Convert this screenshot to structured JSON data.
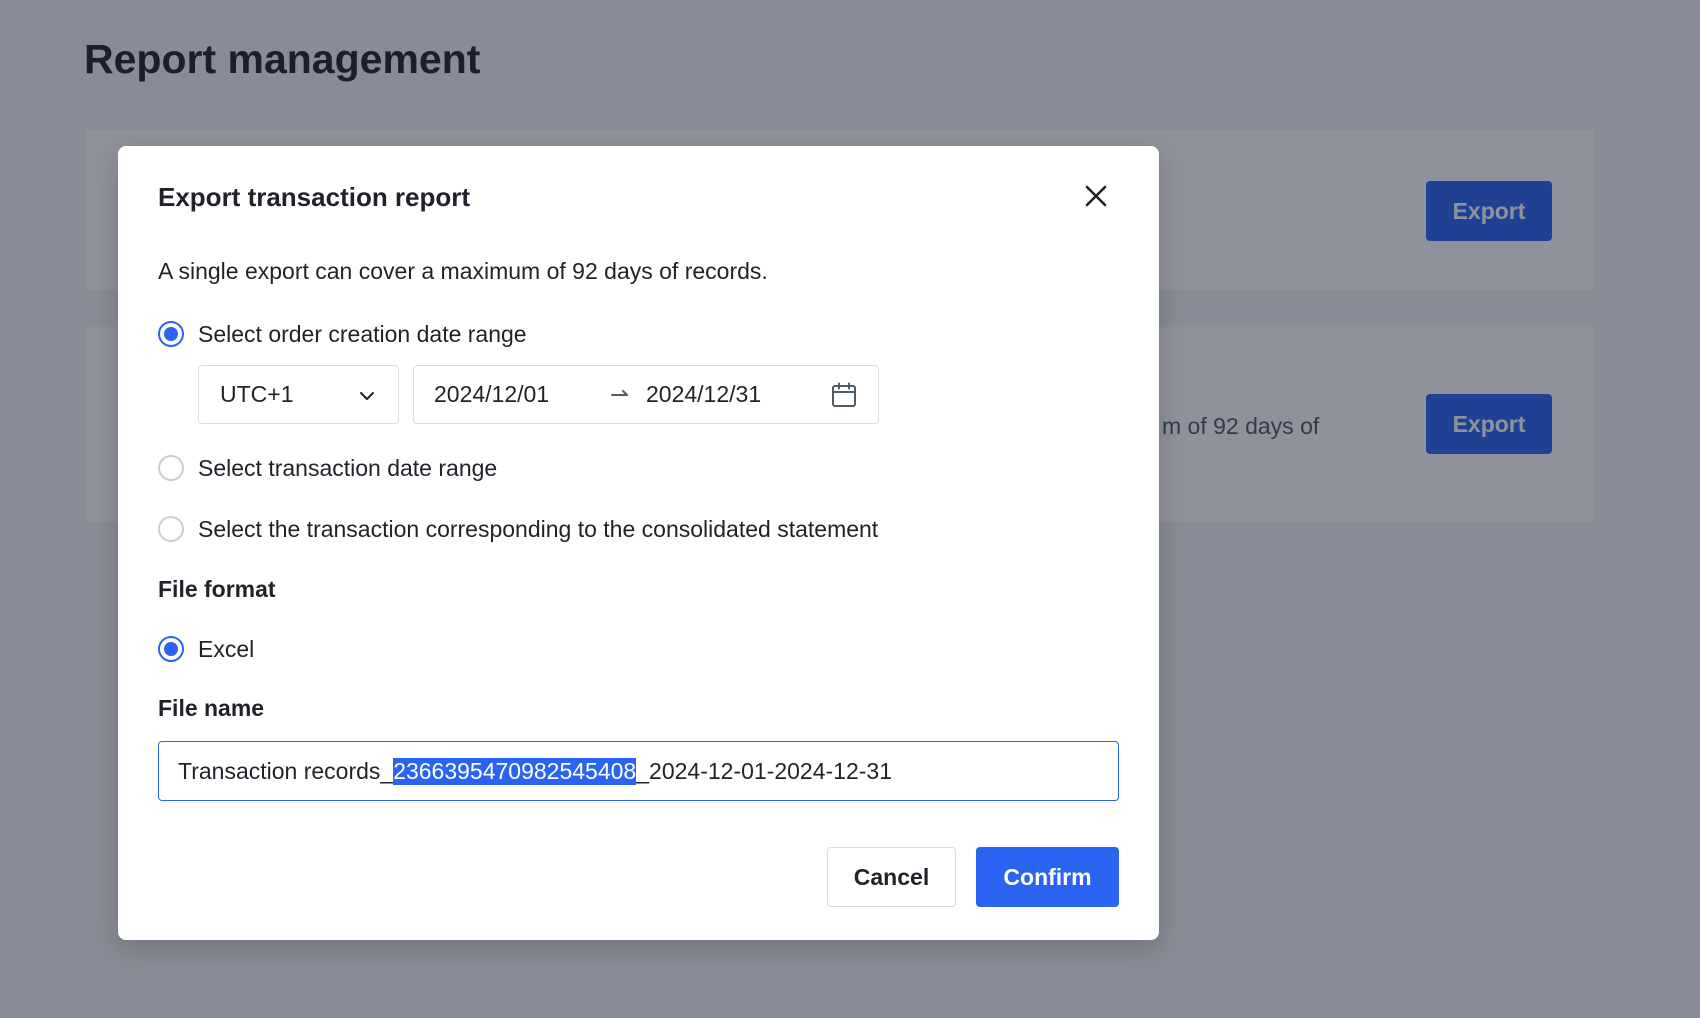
{
  "page": {
    "title": "Report management"
  },
  "background": {
    "card1": {
      "export_label": "Export"
    },
    "card2": {
      "text_fragment": "m of 92 days of",
      "export_label": "Export"
    }
  },
  "modal": {
    "title": "Export transaction report",
    "hint": "A single export can cover a maximum of 92 days of records.",
    "date_options": [
      {
        "label": "Select order creation date range",
        "checked": true
      },
      {
        "label": "Select transaction date range",
        "checked": false
      },
      {
        "label": "Select the transaction corresponding to the consolidated statement",
        "checked": false
      }
    ],
    "timezone": {
      "value": "UTC+1"
    },
    "date_range": {
      "start": "2024/12/01",
      "end": "2024/12/31"
    },
    "file_format": {
      "label": "File format",
      "options": [
        {
          "label": "Excel",
          "checked": true
        }
      ]
    },
    "file_name": {
      "label": "File name",
      "value_prefix": "Transaction records_",
      "value_selected": "2366395470982545408",
      "value_suffix": "_2024-12-01-2024-12-31"
    },
    "buttons": {
      "cancel": "Cancel",
      "confirm": "Confirm"
    }
  },
  "colors": {
    "primary": "#2b64f0",
    "overlay": "rgba(20, 28, 46, 0.48)",
    "text": "#1f2329"
  }
}
